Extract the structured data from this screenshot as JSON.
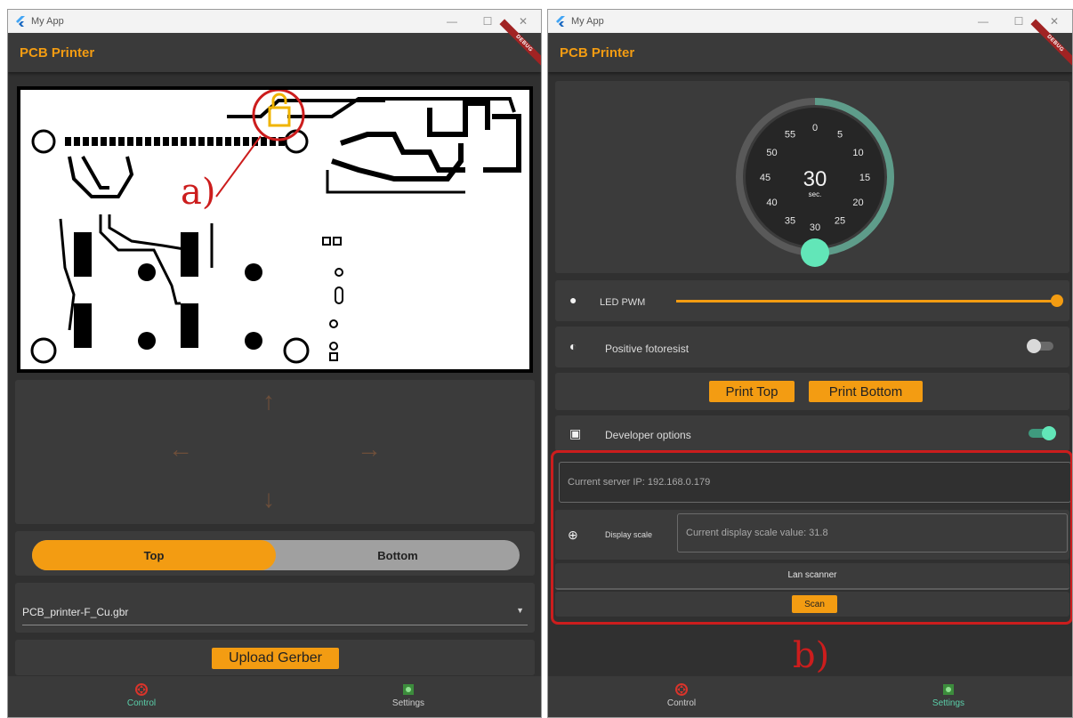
{
  "window_title": "My App",
  "window_controls": [
    "—",
    "☐",
    "✕"
  ],
  "app_title": "PCB Printer",
  "debug_banner": "DEBUG",
  "left": {
    "annotation": "a)",
    "arrows": {
      "up": "↑",
      "down": "↓",
      "left": "←",
      "right": "→"
    },
    "side_toggle": {
      "top_label": "Top",
      "bottom_label": "Bottom",
      "selected": "Top"
    },
    "file_dropdown": {
      "value": "PCB_printer-F_Cu.gbr"
    },
    "upload_button": "Upload Gerber",
    "nav": [
      {
        "label": "Control",
        "icon": "control-icon",
        "active": true
      },
      {
        "label": "Settings",
        "icon": "settings-icon",
        "active": false
      }
    ]
  },
  "right": {
    "annotation": "b)",
    "timer": {
      "value": "30",
      "unit": "sec.",
      "ticks": [
        "0",
        "5",
        "10",
        "15",
        "20",
        "25",
        "30",
        "35",
        "40",
        "45",
        "50",
        "55"
      ],
      "progress_fraction": 0.5
    },
    "led_pwm": {
      "label": "LED PWM",
      "value_fraction": 1.0,
      "icon": "lightbulb-icon"
    },
    "positive_fotoresist": {
      "label": "Positive fotoresist",
      "enabled": false,
      "icon": "contrast-icon"
    },
    "print_top": "Print Top",
    "print_bottom": "Print Bottom",
    "developer_options": {
      "label": "Developer options",
      "enabled": true,
      "icon": "developer-board-icon"
    },
    "server_ip_field": {
      "placeholder": "Current server IP: 192.168.0.179"
    },
    "display_scale": {
      "label": "Display scale",
      "placeholder": "Current display scale value: 31.8",
      "icon": "zoom-in-icon"
    },
    "lan_scanner": {
      "label": "Lan scanner",
      "button": "Scan"
    },
    "nav": [
      {
        "label": "Control",
        "icon": "control-icon",
        "active": false
      },
      {
        "label": "Settings",
        "icon": "settings-icon",
        "active": true
      }
    ]
  },
  "colors": {
    "accent": "#f39c12",
    "teal": "#5bcfaa",
    "background": "#303030",
    "card": "#3b3b3b",
    "annotation_red": "#cc1d1d"
  }
}
